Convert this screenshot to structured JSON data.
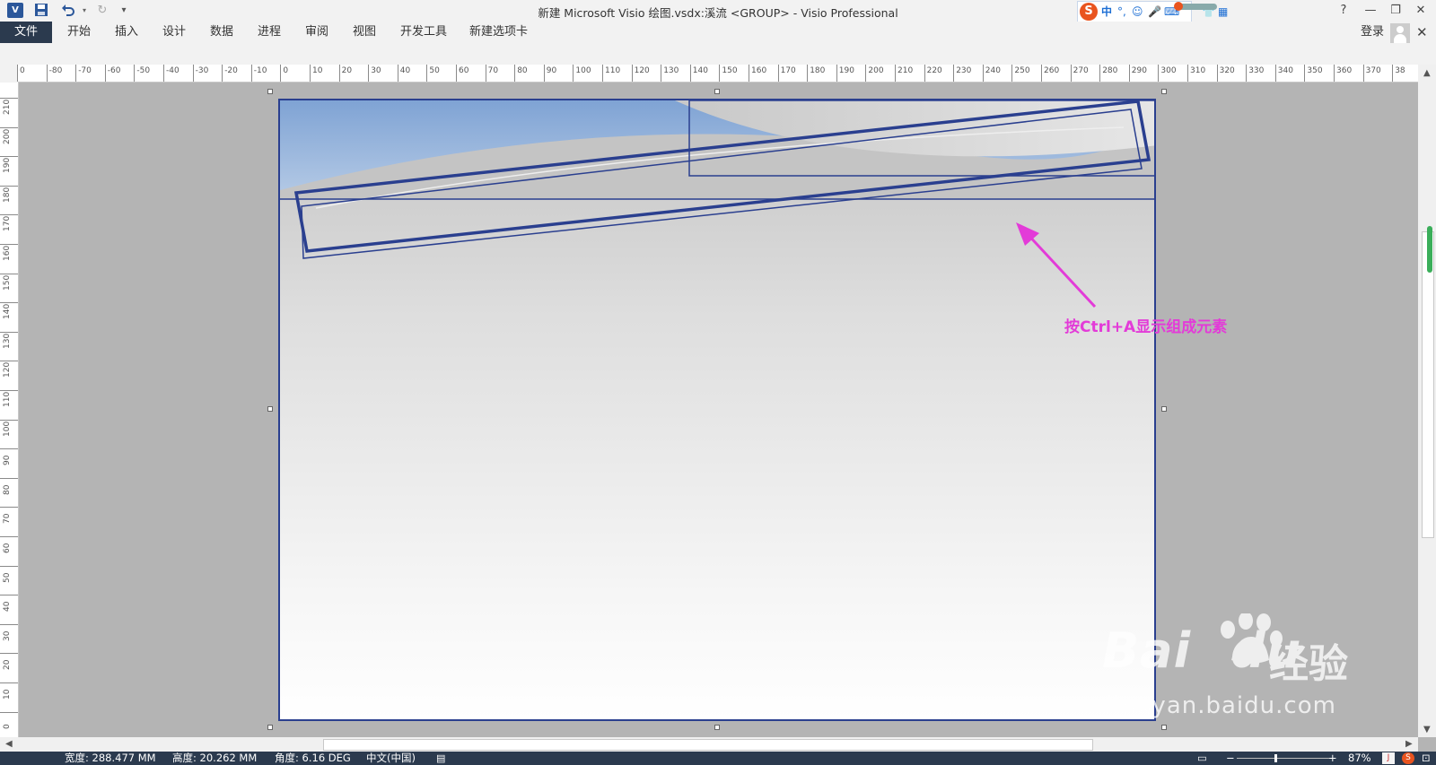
{
  "window": {
    "title": "新建 Microsoft Visio 绘图.vsdx:溪流 <GROUP> - Visio Professional",
    "app_icon_label": "V",
    "quick_access": {
      "save_icon": "save-icon",
      "undo_icon": "undo-icon",
      "redo_icon": "redo-icon",
      "customize_icon": "dropdown-icon"
    },
    "controls": {
      "help": "?",
      "minimize": "—",
      "restore": "❐",
      "close": "✕"
    }
  },
  "ime": {
    "logo": "S",
    "mode": "中",
    "punct": "°,",
    "items": [
      "☺",
      "🎤",
      "⌨",
      "👕",
      "▦"
    ]
  },
  "ribbon": {
    "file_tab": "文件",
    "tabs": [
      "开始",
      "插入",
      "设计",
      "数据",
      "进程",
      "审阅",
      "视图",
      "开发工具",
      "新建选项卡"
    ],
    "login": "登录",
    "close": "✕"
  },
  "rulers": {
    "horizontal": [
      "0",
      "-80",
      "-70",
      "-60",
      "-50",
      "-40",
      "-30",
      "-20",
      "-10",
      "0",
      "10",
      "20",
      "30",
      "40",
      "50",
      "60",
      "70",
      "80",
      "90",
      "100",
      "110",
      "120",
      "130",
      "140",
      "150",
      "160",
      "170",
      "180",
      "190",
      "200",
      "210",
      "220",
      "230",
      "240",
      "250",
      "260",
      "270",
      "280",
      "290",
      "300",
      "310",
      "320",
      "330",
      "340",
      "350",
      "360",
      "370",
      "38"
    ],
    "vertical": [
      "210",
      "200",
      "190",
      "180",
      "170",
      "160",
      "150",
      "140",
      "130",
      "120",
      "110",
      "100",
      "90",
      "80",
      "70",
      "60",
      "50",
      "40",
      "30",
      "20",
      "10",
      "0"
    ]
  },
  "annotation": {
    "text": "按Ctrl+A显示组成元素",
    "color": "#e33bd8"
  },
  "watermark": {
    "brand": "Bai",
    "brand2": "du",
    "product": "经验",
    "url": "jingyan.baidu.com"
  },
  "status": {
    "width": "宽度: 288.477 MM",
    "height": "高度: 20.262 MM",
    "angle": "角度: 6.16 DEG",
    "language": "中文(中国)",
    "zoom": "87%"
  },
  "colors": {
    "accent": "#2b579a",
    "selection_outline": "#2a3f8f",
    "status_bg": "#2b3a4e"
  }
}
